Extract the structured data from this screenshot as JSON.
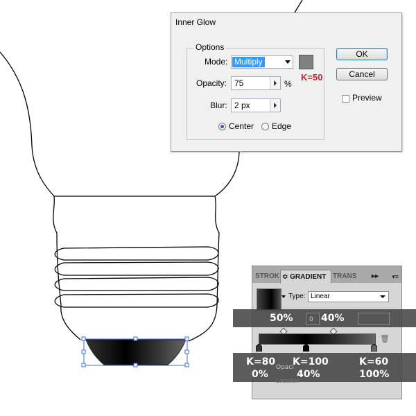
{
  "dialog": {
    "title": "Inner Glow",
    "options_legend": "Options",
    "mode": {
      "label": "Mode:",
      "value": "Multiply"
    },
    "opacity": {
      "label": "Opacity:",
      "value": "75",
      "unit": "%"
    },
    "blur": {
      "label": "Blur:",
      "value": "2 px"
    },
    "radio_center": "Center",
    "radio_edge": "Edge",
    "ok": "OK",
    "cancel": "Cancel",
    "preview": "Preview",
    "swatch_color": "#808080",
    "swatch_note": "K=50"
  },
  "gradient_panel": {
    "tabs": [
      "STROK",
      "≎ GRADIENT",
      "TRANS"
    ],
    "tab_arrows": "▸▸",
    "type_label": "Type:",
    "type_value": "Linear",
    "angle_value": "0",
    "overlay_top": {
      "left": "50%",
      "right": "40%"
    },
    "stops": [
      {
        "k": "K=80",
        "location": "0%"
      },
      {
        "k": "K=100",
        "location": "40%"
      },
      {
        "k": "K=60",
        "location": "100%"
      }
    ],
    "faded_labels": [
      "Opaci",
      "Location"
    ]
  }
}
